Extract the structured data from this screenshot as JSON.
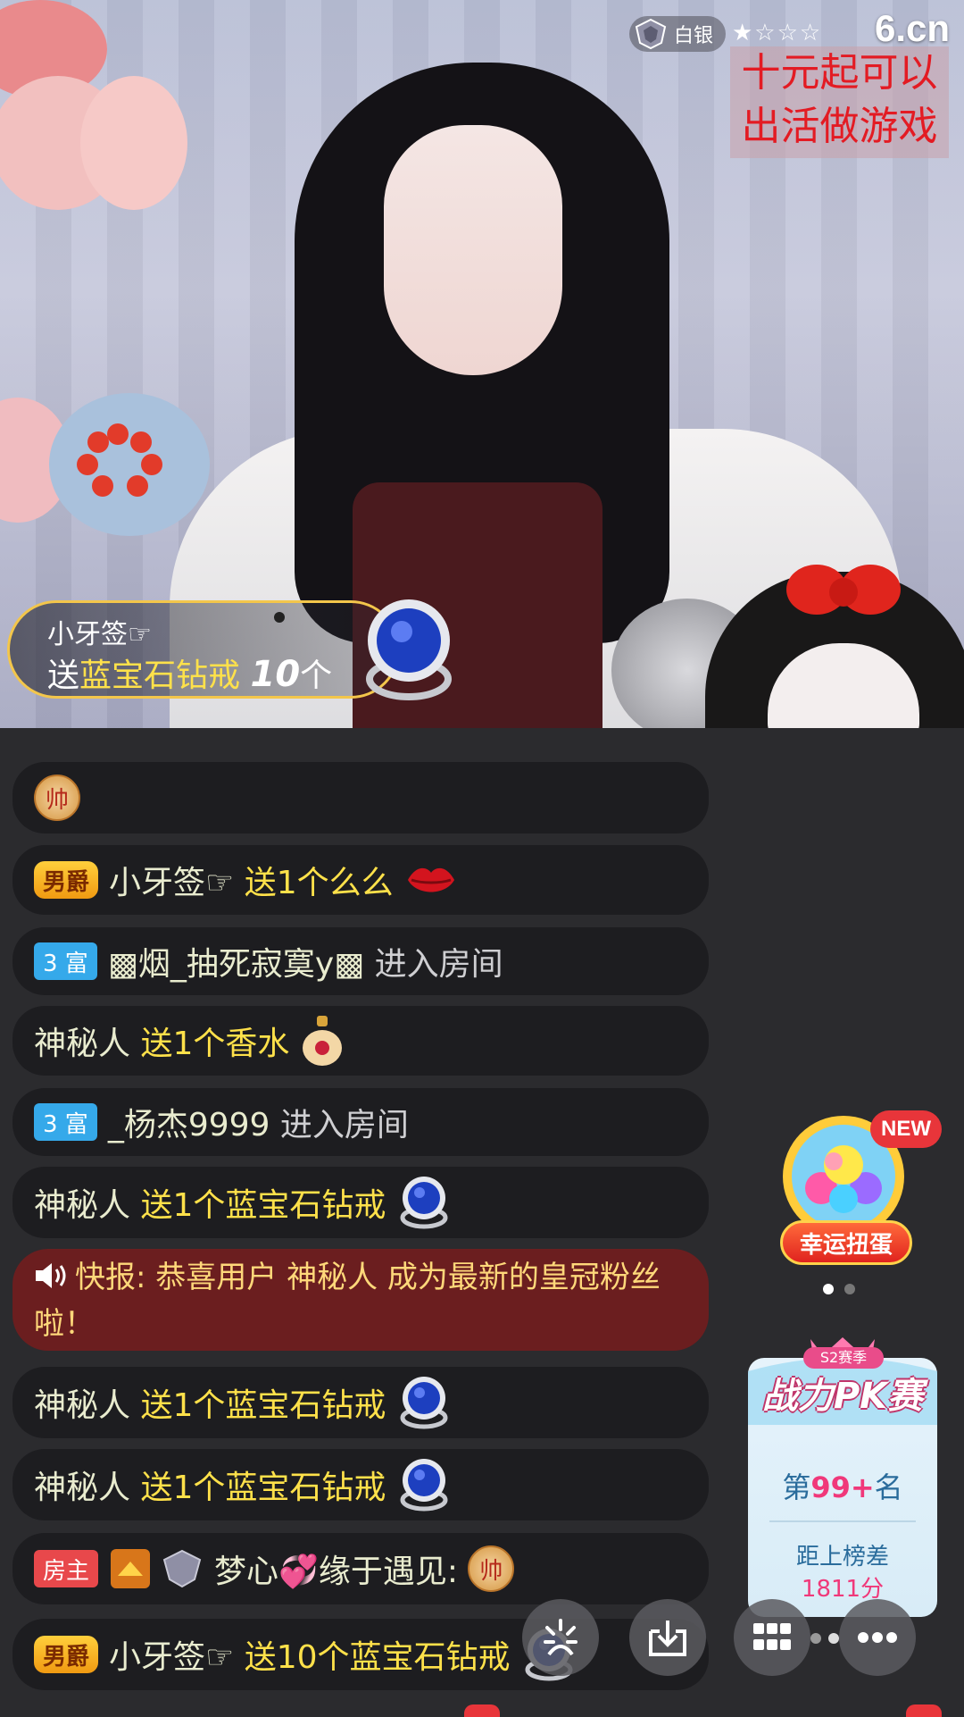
{
  "overlay": {
    "rank_badge": "白银",
    "stars": "★☆☆☆",
    "logo": "6.cn",
    "promo_line1": "十元起可以",
    "promo_line2": "出活做游戏"
  },
  "gift_banner": {
    "sender": "小牙签☞",
    "send_word": "送",
    "gift": "蓝宝石钻戒",
    "count": "10",
    "unit": "个"
  },
  "chat": [
    {
      "type": "icon_only",
      "badge": "帅"
    },
    {
      "type": "gift",
      "tag": "男爵",
      "user": "小牙签☞",
      "text": "送1个么么",
      "icon": "kiss-lips-icon"
    },
    {
      "type": "enter",
      "tag": "3 富",
      "user": "▩烟_抽死寂寞y▩",
      "text": "进入房间"
    },
    {
      "type": "gift",
      "user": "神秘人",
      "text": "送1个香水",
      "icon": "perfume-icon"
    },
    {
      "type": "enter",
      "tag": "3 富",
      "user": "_杨杰9999",
      "text": "进入房间"
    },
    {
      "type": "gift",
      "user": "神秘人",
      "text": "送1个蓝宝石钻戒",
      "icon": "sapphire-ring-icon"
    },
    {
      "type": "notice",
      "text": "快报: 恭喜用户 神秘人 成为最新的皇冠粉丝啦！"
    },
    {
      "type": "gift",
      "user": "神秘人",
      "text": "送1个蓝宝石钻戒",
      "icon": "sapphire-ring-icon"
    },
    {
      "type": "gift",
      "user": "神秘人",
      "text": "送1个蓝宝石钻戒",
      "icon": "sapphire-ring-icon"
    },
    {
      "type": "chat",
      "tag": "房主",
      "user": "梦心💞缘于遇见:",
      "badge": "帅"
    },
    {
      "type": "gift",
      "tag": "男爵",
      "user": "小牙签☞",
      "text": "送10个蓝宝石钻戒",
      "icon": "sapphire-ring-icon"
    }
  ],
  "side": {
    "new_badge": "NEW",
    "gacha_label": "幸运扭蛋",
    "pk_season": "S2赛季",
    "pk_title": "战力PK赛",
    "pk_rank_prefix": "第",
    "pk_rank_value": "99+",
    "pk_rank_suffix": "名",
    "pk_gap_label": "距上榜差",
    "pk_gap_value": "1811分"
  },
  "colors": {
    "gold": "#ffe14a",
    "notice_bg": "#6b1e1f",
    "fu_tag": "#35a9ea",
    "host_tag": "#e8484b",
    "new_badge": "#e8353a"
  }
}
